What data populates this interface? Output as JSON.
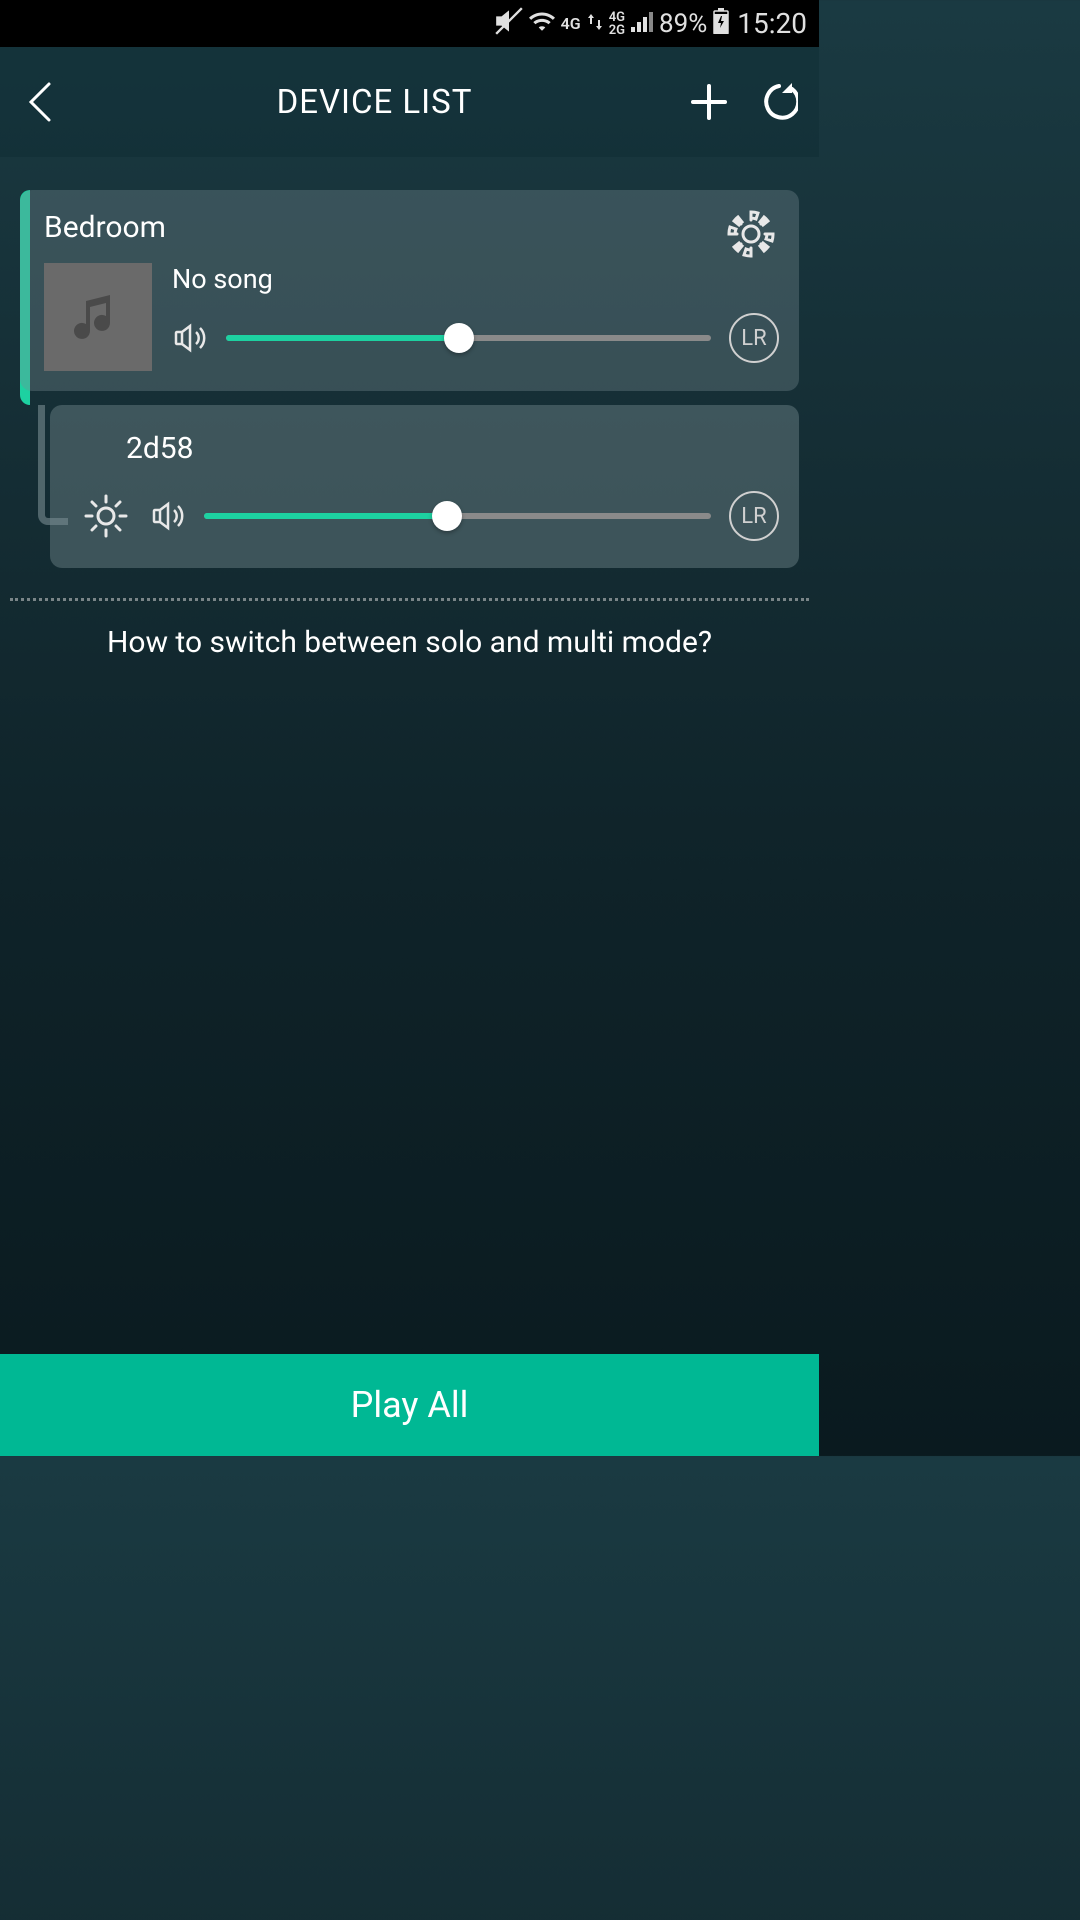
{
  "statusBar": {
    "network1": "4G",
    "network2Top": "4G",
    "network2Bottom": "2G",
    "battery": "89%",
    "time": "15:20"
  },
  "header": {
    "title": "DEVICE LIST"
  },
  "devices": {
    "main": {
      "name": "Bedroom",
      "songTitle": "No song",
      "volumePercent": 48,
      "channel": "LR"
    },
    "sub": {
      "name": "2d58",
      "volumePercent": 48,
      "channel": "LR"
    }
  },
  "helpText": "How to switch between solo and multi mode?",
  "playAllLabel": "Play All"
}
